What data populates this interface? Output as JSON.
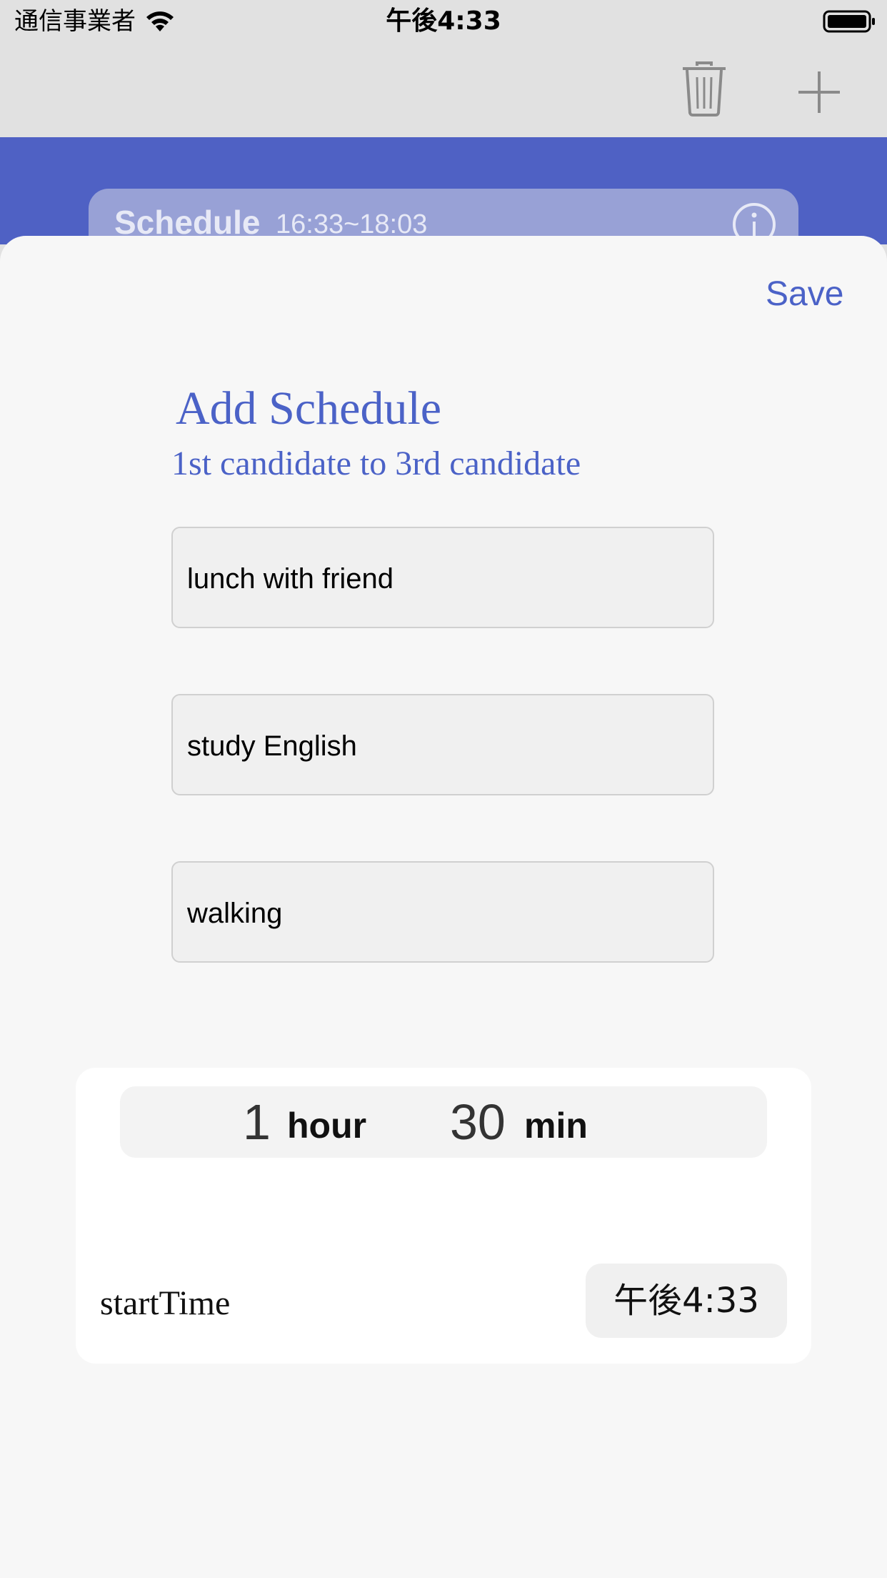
{
  "status_bar": {
    "carrier": "通信事業者",
    "time": "午後4:33",
    "wifi_icon": "wifi-icon",
    "battery_icon": "battery-icon"
  },
  "nav_bar": {
    "trash_icon": "trash-icon",
    "add_icon": "plus-icon"
  },
  "background_list": {
    "color": "#4f61c4",
    "item": {
      "title": "Schedule",
      "time": "16:33~18:03",
      "info_icon": "info-icon"
    }
  },
  "sheet": {
    "save_label": "Save",
    "title": "Add Schedule",
    "subtitle": "1st candidate to 3rd candidate",
    "candidates": [
      {
        "value": "lunch with friend"
      },
      {
        "value": "study English"
      },
      {
        "value": "walking"
      }
    ],
    "duration": {
      "hours": "1",
      "hour_label": "hour",
      "minutes": "30",
      "min_label": "min"
    },
    "start_time": {
      "label": "startTime",
      "value": "午後4:33"
    }
  },
  "colors": {
    "accent": "#4b62c7",
    "nav_background": "#e1e1e1",
    "sheet_background": "#f7f7f7"
  }
}
